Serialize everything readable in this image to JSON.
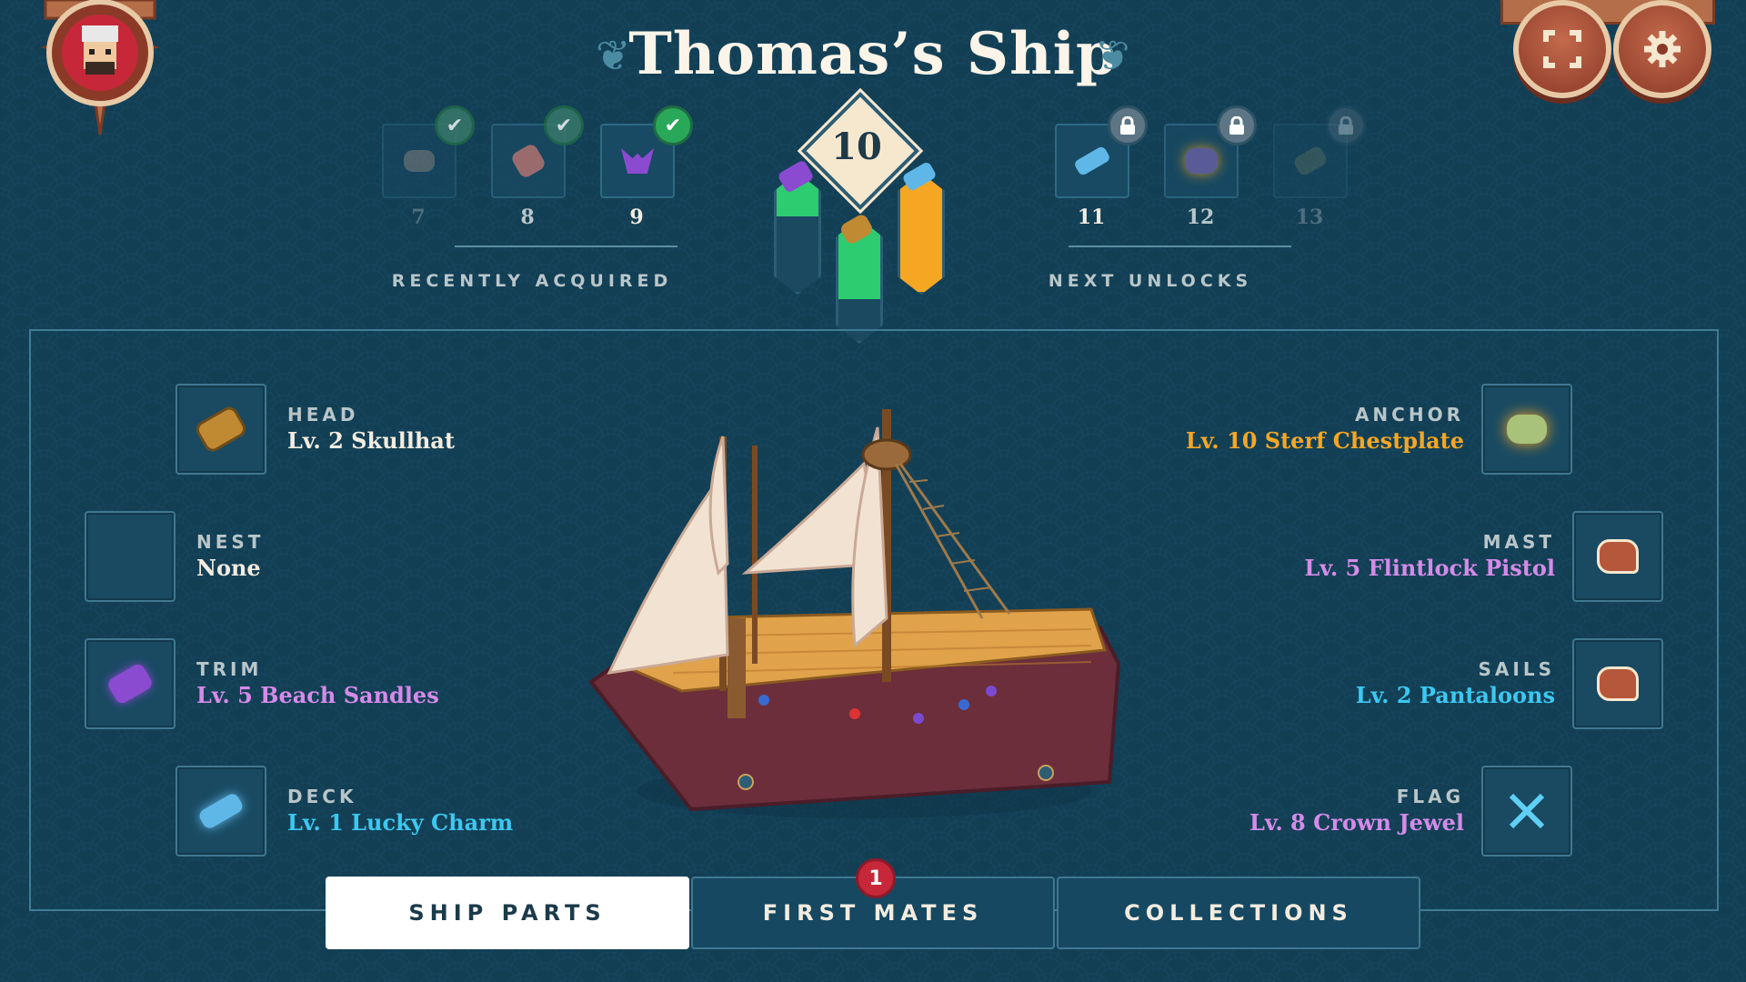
{
  "header": {
    "title": "Thomas’s Ship"
  },
  "recent": {
    "label": "RECENTLY ACQUIRED",
    "items": [
      {
        "level": "7",
        "icon": "rock-item-icon",
        "color": "#9a8f8a"
      },
      {
        "level": "8",
        "icon": "bone-item-icon",
        "color": "#c87a74"
      },
      {
        "level": "9",
        "icon": "bat-item-icon",
        "color": "#8b4bd1"
      }
    ]
  },
  "level": {
    "current": "10"
  },
  "unlocks": {
    "label": "NEXT UNLOCKS",
    "items": [
      {
        "level": "11",
        "icon": "spyglass-item-icon",
        "color": "#5fb7e8"
      },
      {
        "level": "12",
        "icon": "ore-item-icon",
        "color": "#6b62a8"
      },
      {
        "level": "13",
        "icon": "log-item-icon",
        "color": "#7b8a6e"
      }
    ]
  },
  "parts": {
    "left": [
      {
        "label": "HEAD",
        "value": "Lv. 2 Skullhat",
        "color": "#f3ece0",
        "icon": "log-item-icon"
      },
      {
        "label": "NEST",
        "value": "None",
        "color": "#f3ece0",
        "icon": ""
      },
      {
        "label": "TRIM",
        "value": "Lv. 5 Beach Sandles",
        "color": "#d58be8",
        "icon": "crystal-log-icon"
      },
      {
        "label": "DECK",
        "value": "Lv. 1 Lucky Charm",
        "color": "#3cc8f0",
        "icon": "spyglass-item-icon"
      }
    ],
    "right": [
      {
        "label": "ANCHOR",
        "value": "Lv. 10 Sterf Chestplate",
        "color": "#f5a623",
        "icon": "green-rock-icon"
      },
      {
        "label": "MAST",
        "value": "Lv. 5 Flintlock Pistol",
        "color": "#d58be8",
        "icon": "meat-icon"
      },
      {
        "label": "SAILS",
        "value": "Lv. 2 Pantaloons",
        "color": "#3cc8f0",
        "icon": "meat-icon"
      },
      {
        "label": "FLAG",
        "value": "Lv. 8 Crown Jewel",
        "color": "#d58be8",
        "icon": "crossed-swords-icon"
      }
    ]
  },
  "tabs": [
    {
      "label": "SHIP PARTS",
      "active": true
    },
    {
      "label": "FIRST MATES",
      "badge": "1"
    },
    {
      "label": "COLLECTIONS"
    }
  ]
}
